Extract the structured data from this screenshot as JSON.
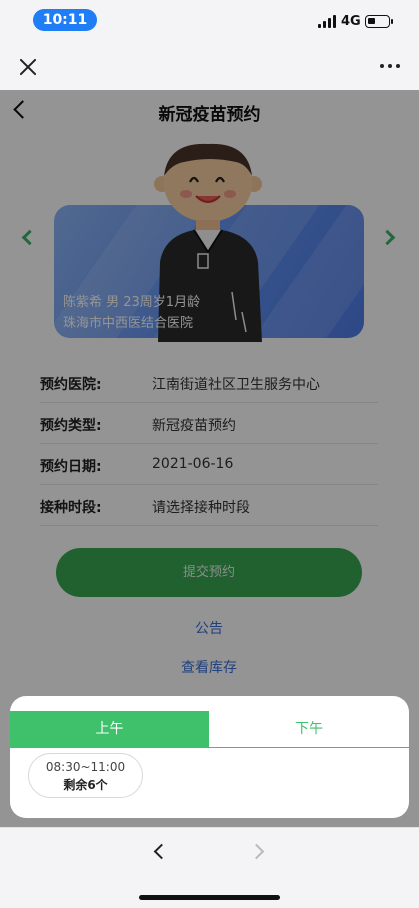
{
  "status_bar": {
    "time": "10:11",
    "network": "4G"
  },
  "wechat_bar": {
    "close_icon": "close-x-icon",
    "more_icon": "more-dots-icon"
  },
  "header": {
    "title": "新冠疫苗预约",
    "back_icon": "chevron-left-icon"
  },
  "profile": {
    "line1": "陈紫希 男 23周岁1月龄",
    "line2": "珠海市中西医结合医院"
  },
  "details": [
    {
      "label": "预约医院:",
      "value": "江南街道社区卫生服务中心"
    },
    {
      "label": "预约类型:",
      "value": "新冠疫苗预约"
    },
    {
      "label": "预约日期:",
      "value": "2021-06-16"
    },
    {
      "label": "接种时段:",
      "value": "请选择接种时段"
    }
  ],
  "actions": {
    "submit": "提交预约",
    "notice": "公告",
    "inventory": "查看库存"
  },
  "time_sheet": {
    "tabs": [
      "上午",
      "下午"
    ],
    "selected_tab": "上午",
    "slots": [
      {
        "time": "08:30~11:00",
        "remaining": "剩余6个"
      }
    ]
  },
  "colors": {
    "accent_green": "#3ec16a",
    "button_green": "#3aa853",
    "link_blue": "#3a6fd8",
    "time_pill": "#1f7ef5"
  }
}
